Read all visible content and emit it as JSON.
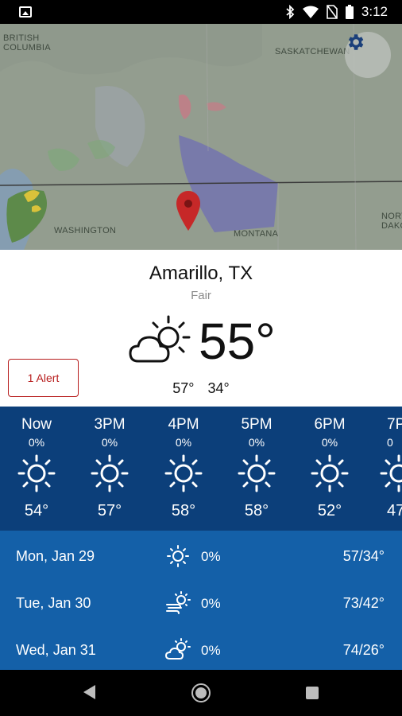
{
  "status_bar": {
    "time": "3:12",
    "icons": [
      "image-icon",
      "bluetooth-icon",
      "wifi-icon",
      "no-sim-icon",
      "battery-icon"
    ]
  },
  "map": {
    "labels": {
      "british_columbia": "BRITISH\nCOLUMBIA",
      "saskatchewan": "SASKATCHEWAN",
      "washington": "WASHINGTON",
      "montana": "MONTANA",
      "north_dakota": "NORT\nDAKO"
    },
    "pin_icon": "location-pin-icon",
    "settings_icon": "gear-icon"
  },
  "current": {
    "city": "Amarillo, TX",
    "condition": "Fair",
    "temperature": "55°",
    "high": "57°",
    "low": "34°",
    "icon": "partly-cloudy-icon",
    "alert_label": "1 Alert"
  },
  "hourly": [
    {
      "label": "Now",
      "precip": "0%",
      "temp": "54°",
      "icon": "sun-icon"
    },
    {
      "label": "3PM",
      "precip": "0%",
      "temp": "57°",
      "icon": "sun-icon"
    },
    {
      "label": "4PM",
      "precip": "0%",
      "temp": "58°",
      "icon": "sun-icon"
    },
    {
      "label": "5PM",
      "precip": "0%",
      "temp": "58°",
      "icon": "sun-icon"
    },
    {
      "label": "6PM",
      "precip": "0%",
      "temp": "52°",
      "icon": "sun-icon"
    },
    {
      "label": "7P",
      "precip": "0",
      "temp": "47",
      "icon": "sun-icon"
    }
  ],
  "daily": [
    {
      "date": "Mon, Jan 29",
      "precip": "0%",
      "temps": "57/34°",
      "icon": "sun-icon"
    },
    {
      "date": "Tue, Jan 30",
      "precip": "0%",
      "temps": "73/42°",
      "icon": "windy-sun-icon"
    },
    {
      "date": "Wed, Jan 31",
      "precip": "0%",
      "temps": "74/26°",
      "icon": "partly-cloudy-icon"
    }
  ],
  "colors": {
    "hourly_bg": "#0c3f7a",
    "daily_bg": "#1460a8",
    "alert": "#b71c1c",
    "settings_icon": "#1a3f7a",
    "pin": "#c62828"
  }
}
